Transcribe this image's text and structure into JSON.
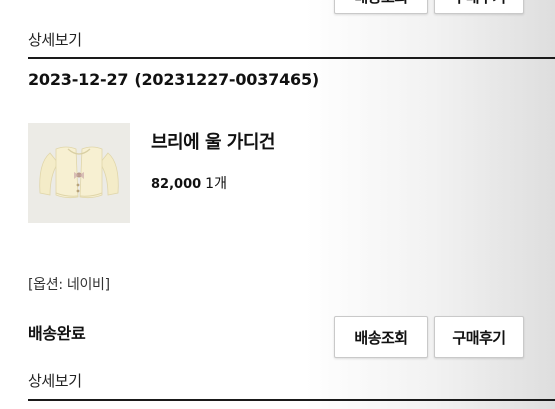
{
  "top": {
    "partial_text": "",
    "button1_label": "배송조회",
    "button2_label": "구매후기"
  },
  "order1": {
    "detail_link": "상세보기"
  },
  "order2": {
    "date": "2023-12-27",
    "order_number": "(20231227-0037465)",
    "product": {
      "name": "브리에 울 가디건",
      "price": "82,000",
      "quantity": "1개",
      "image": "cream-knit-cardigan-thumbnail",
      "image_bg": "#ecebe6"
    },
    "option": "[옵션: 네이비]",
    "status": "배송완료",
    "track_button": "배송조회",
    "review_button": "구매후기",
    "detail_link": "상세보기"
  }
}
